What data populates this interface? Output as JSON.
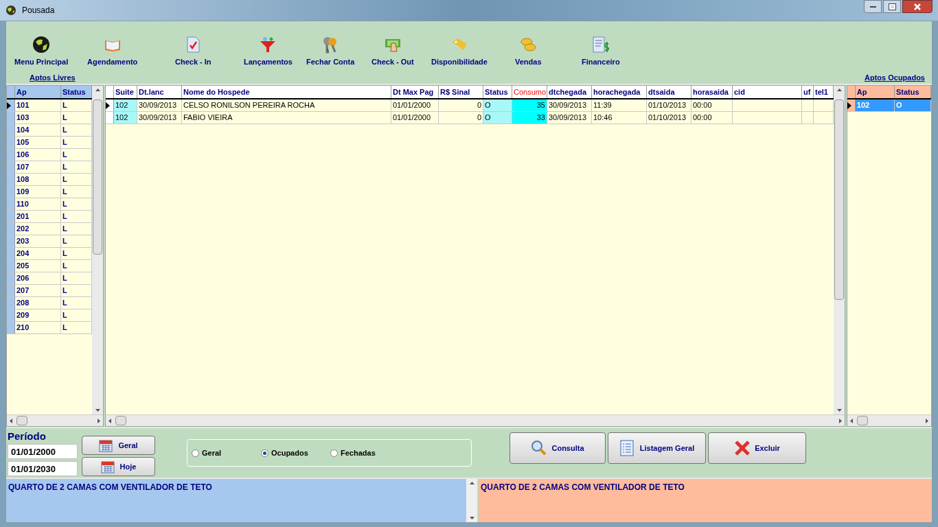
{
  "window": {
    "title": "Pousada"
  },
  "toolbar": [
    {
      "label": "Menu Principal"
    },
    {
      "label": "Agendamento"
    },
    {
      "label": "Check  - In"
    },
    {
      "label": "Lançamentos"
    },
    {
      "label": "Fechar Conta"
    },
    {
      "label": "Check - Out"
    },
    {
      "label": "Disponibilidade"
    },
    {
      "label": "Vendas"
    },
    {
      "label": "Financeiro"
    }
  ],
  "free_rooms": {
    "title": "Aptos Livres",
    "columns": [
      "Ap",
      "Status"
    ],
    "rows": [
      {
        "cells": [
          "101",
          "L"
        ],
        "selected": true
      },
      {
        "cells": [
          "103",
          "L"
        ],
        "selected": false
      },
      {
        "cells": [
          "104",
          "L"
        ],
        "selected": false
      },
      {
        "cells": [
          "105",
          "L"
        ],
        "selected": false
      },
      {
        "cells": [
          "106",
          "L"
        ],
        "selected": false
      },
      {
        "cells": [
          "107",
          "L"
        ],
        "selected": false
      },
      {
        "cells": [
          "108",
          "L"
        ],
        "selected": false
      },
      {
        "cells": [
          "109",
          "L"
        ],
        "selected": false
      },
      {
        "cells": [
          "110",
          "L"
        ],
        "selected": false
      },
      {
        "cells": [
          "201",
          "L"
        ],
        "selected": false
      },
      {
        "cells": [
          "202",
          "L"
        ],
        "selected": false
      },
      {
        "cells": [
          "203",
          "L"
        ],
        "selected": false
      },
      {
        "cells": [
          "204",
          "L"
        ],
        "selected": false
      },
      {
        "cells": [
          "205",
          "L"
        ],
        "selected": false
      },
      {
        "cells": [
          "206",
          "L"
        ],
        "selected": false
      },
      {
        "cells": [
          "207",
          "L"
        ],
        "selected": false
      },
      {
        "cells": [
          "208",
          "L"
        ],
        "selected": false
      },
      {
        "cells": [
          "209",
          "L"
        ],
        "selected": false
      },
      {
        "cells": [
          "210",
          "L"
        ],
        "selected": false
      }
    ]
  },
  "stays": {
    "columns": [
      "Suite",
      "Dt.lanc",
      "Nome do Hospede",
      "Dt Max Pag",
      "R$ Sinal",
      "Status",
      "Consumo",
      "dtchegada",
      "horachegada",
      "dtsaida",
      "horasaida",
      "cid",
      "uf",
      "tel1"
    ],
    "rows": [
      {
        "cells": [
          "102",
          "30/09/2013",
          "CELSO RONILSON PEREIRA ROCHA",
          "01/01/2000",
          "0",
          "O",
          "35",
          "30/09/2013",
          "11:39",
          "01/10/2013",
          "00:00",
          "",
          "",
          ""
        ],
        "selected": true
      },
      {
        "cells": [
          "102",
          "30/09/2013",
          "FABIO VIEIRA",
          "01/01/2000",
          "0",
          "O",
          "33",
          "30/09/2013",
          "10:46",
          "01/10/2013",
          "00:00",
          "",
          "",
          ""
        ],
        "selected": false
      }
    ]
  },
  "occupied_rooms": {
    "title": "Aptos Ocupados",
    "columns": [
      "Ap",
      "Status"
    ],
    "rows": [
      {
        "cells": [
          "102",
          "O"
        ],
        "selected": true
      }
    ]
  },
  "period": {
    "label": "Período",
    "start": "01/01/2000",
    "end": "01/01/2030",
    "buttons": [
      "Geral",
      "Hoje"
    ]
  },
  "filter": [
    {
      "label": "Geral",
      "selected": false
    },
    {
      "label": "Ocupados",
      "selected": true
    },
    {
      "label": "Fechadas",
      "selected": false
    }
  ],
  "actions": [
    "Consulta",
    "Listagem Geral",
    "Excluir"
  ],
  "notes": {
    "free": "QUARTO DE 2 CAMAS COM VENTILADOR DE TETO",
    "occupied": "QUARTO DE 2 CAMAS COM VENTILADOR DE TETO"
  }
}
